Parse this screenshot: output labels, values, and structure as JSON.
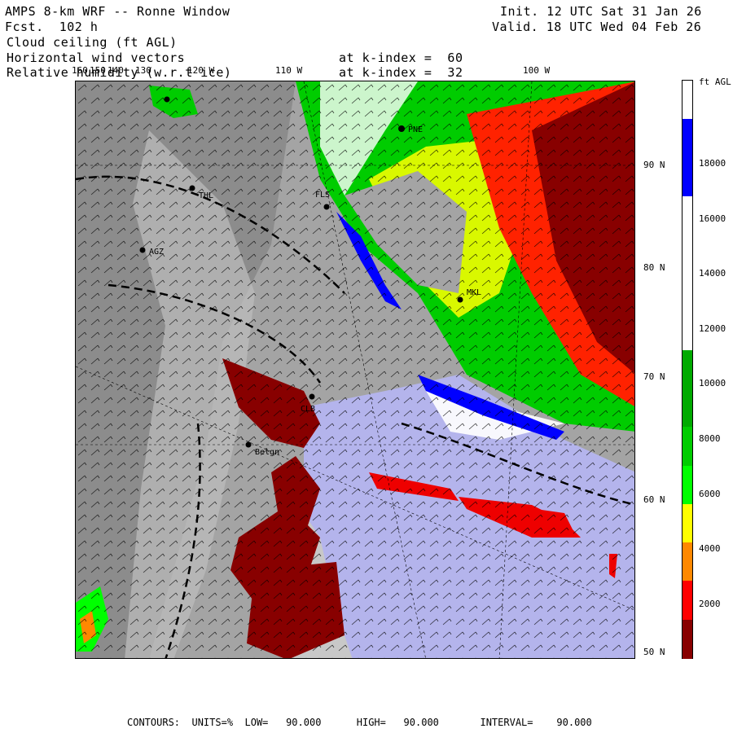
{
  "header": {
    "model": "AMPS 8-km WRF -- Ronne Window",
    "forecast": "Fcst.  102 h",
    "field1": "Cloud ceiling (ft AGL)",
    "field2": "Horizontal wind vectors",
    "field3": "Relative humidity (w.r.t ice)",
    "level1": "at k-index =  60",
    "level2": "at k-index =  32",
    "init": "Init. 12 UTC Sat 31 Jan 26",
    "valid": "Valid. 18 UTC Wed 04 Feb 26"
  },
  "lon_labels": [
    "160",
    "150",
    "140",
    "130",
    "120 W",
    "110 W",
    "100 W"
  ],
  "lat_labels": [
    "90 N",
    "80 N",
    "70 N",
    "60 N",
    "50 N"
  ],
  "stations": [
    {
      "name": "PNE"
    },
    {
      "name": "THL"
    },
    {
      "name": "FLS"
    },
    {
      "name": "AGZ"
    },
    {
      "name": "MKL"
    },
    {
      "name": "CLB"
    },
    {
      "name": "Belgn"
    }
  ],
  "colorbar": {
    "unit": "ft AGL",
    "labels": [
      "18000",
      "16000",
      "14000",
      "12000",
      "10000",
      "8000",
      "6000",
      "4000",
      "2000"
    ],
    "segments": [
      {
        "color": "#ffffff"
      },
      {
        "color": "#0000ff"
      },
      {
        "color": "#0000ff"
      },
      {
        "color": "#ffffff"
      },
      {
        "color": "#ffffff"
      },
      {
        "color": "#ffffff"
      },
      {
        "color": "#ffffff"
      },
      {
        "color": "#00aa00"
      },
      {
        "color": "#00aa00"
      },
      {
        "color": "#00cc00"
      },
      {
        "color": "#00ff00"
      },
      {
        "color": "#ffff00"
      },
      {
        "color": "#ff8800"
      },
      {
        "color": "#ff0000"
      },
      {
        "color": "#880000"
      }
    ]
  },
  "footer": {
    "contours": "CONTOURS:  UNITS=%  LOW=   90.000      HIGH=   90.000       INTERVAL=    90.000"
  },
  "colors": {
    "ocean": "#b4b4ec",
    "land": "#a0a0a0",
    "sea_ice": "#c8c8c8",
    "ceiling_low": "#880000",
    "ceiling_red": "#ee0000",
    "coast": "#0000ff"
  }
}
